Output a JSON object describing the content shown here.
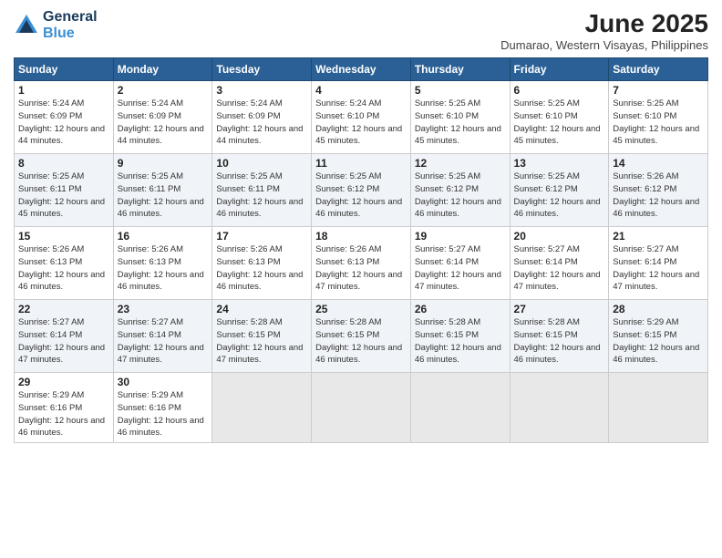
{
  "logo": {
    "line1": "General",
    "line2": "Blue"
  },
  "title": "June 2025",
  "subtitle": "Dumarao, Western Visayas, Philippines",
  "days_header": [
    "Sunday",
    "Monday",
    "Tuesday",
    "Wednesday",
    "Thursday",
    "Friday",
    "Saturday"
  ],
  "weeks": [
    [
      {
        "day": "1",
        "sunrise": "5:24 AM",
        "sunset": "6:09 PM",
        "daylight": "12 hours and 44 minutes."
      },
      {
        "day": "2",
        "sunrise": "5:24 AM",
        "sunset": "6:09 PM",
        "daylight": "12 hours and 44 minutes."
      },
      {
        "day": "3",
        "sunrise": "5:24 AM",
        "sunset": "6:09 PM",
        "daylight": "12 hours and 44 minutes."
      },
      {
        "day": "4",
        "sunrise": "5:24 AM",
        "sunset": "6:10 PM",
        "daylight": "12 hours and 45 minutes."
      },
      {
        "day": "5",
        "sunrise": "5:25 AM",
        "sunset": "6:10 PM",
        "daylight": "12 hours and 45 minutes."
      },
      {
        "day": "6",
        "sunrise": "5:25 AM",
        "sunset": "6:10 PM",
        "daylight": "12 hours and 45 minutes."
      },
      {
        "day": "7",
        "sunrise": "5:25 AM",
        "sunset": "6:10 PM",
        "daylight": "12 hours and 45 minutes."
      }
    ],
    [
      {
        "day": "8",
        "sunrise": "5:25 AM",
        "sunset": "6:11 PM",
        "daylight": "12 hours and 45 minutes."
      },
      {
        "day": "9",
        "sunrise": "5:25 AM",
        "sunset": "6:11 PM",
        "daylight": "12 hours and 46 minutes."
      },
      {
        "day": "10",
        "sunrise": "5:25 AM",
        "sunset": "6:11 PM",
        "daylight": "12 hours and 46 minutes."
      },
      {
        "day": "11",
        "sunrise": "5:25 AM",
        "sunset": "6:12 PM",
        "daylight": "12 hours and 46 minutes."
      },
      {
        "day": "12",
        "sunrise": "5:25 AM",
        "sunset": "6:12 PM",
        "daylight": "12 hours and 46 minutes."
      },
      {
        "day": "13",
        "sunrise": "5:25 AM",
        "sunset": "6:12 PM",
        "daylight": "12 hours and 46 minutes."
      },
      {
        "day": "14",
        "sunrise": "5:26 AM",
        "sunset": "6:12 PM",
        "daylight": "12 hours and 46 minutes."
      }
    ],
    [
      {
        "day": "15",
        "sunrise": "5:26 AM",
        "sunset": "6:13 PM",
        "daylight": "12 hours and 46 minutes."
      },
      {
        "day": "16",
        "sunrise": "5:26 AM",
        "sunset": "6:13 PM",
        "daylight": "12 hours and 46 minutes."
      },
      {
        "day": "17",
        "sunrise": "5:26 AM",
        "sunset": "6:13 PM",
        "daylight": "12 hours and 46 minutes."
      },
      {
        "day": "18",
        "sunrise": "5:26 AM",
        "sunset": "6:13 PM",
        "daylight": "12 hours and 47 minutes."
      },
      {
        "day": "19",
        "sunrise": "5:27 AM",
        "sunset": "6:14 PM",
        "daylight": "12 hours and 47 minutes."
      },
      {
        "day": "20",
        "sunrise": "5:27 AM",
        "sunset": "6:14 PM",
        "daylight": "12 hours and 47 minutes."
      },
      {
        "day": "21",
        "sunrise": "5:27 AM",
        "sunset": "6:14 PM",
        "daylight": "12 hours and 47 minutes."
      }
    ],
    [
      {
        "day": "22",
        "sunrise": "5:27 AM",
        "sunset": "6:14 PM",
        "daylight": "12 hours and 47 minutes."
      },
      {
        "day": "23",
        "sunrise": "5:27 AM",
        "sunset": "6:14 PM",
        "daylight": "12 hours and 47 minutes."
      },
      {
        "day": "24",
        "sunrise": "5:28 AM",
        "sunset": "6:15 PM",
        "daylight": "12 hours and 47 minutes."
      },
      {
        "day": "25",
        "sunrise": "5:28 AM",
        "sunset": "6:15 PM",
        "daylight": "12 hours and 46 minutes."
      },
      {
        "day": "26",
        "sunrise": "5:28 AM",
        "sunset": "6:15 PM",
        "daylight": "12 hours and 46 minutes."
      },
      {
        "day": "27",
        "sunrise": "5:28 AM",
        "sunset": "6:15 PM",
        "daylight": "12 hours and 46 minutes."
      },
      {
        "day": "28",
        "sunrise": "5:29 AM",
        "sunset": "6:15 PM",
        "daylight": "12 hours and 46 minutes."
      }
    ],
    [
      {
        "day": "29",
        "sunrise": "5:29 AM",
        "sunset": "6:16 PM",
        "daylight": "12 hours and 46 minutes."
      },
      {
        "day": "30",
        "sunrise": "5:29 AM",
        "sunset": "6:16 PM",
        "daylight": "12 hours and 46 minutes."
      },
      null,
      null,
      null,
      null,
      null
    ]
  ]
}
